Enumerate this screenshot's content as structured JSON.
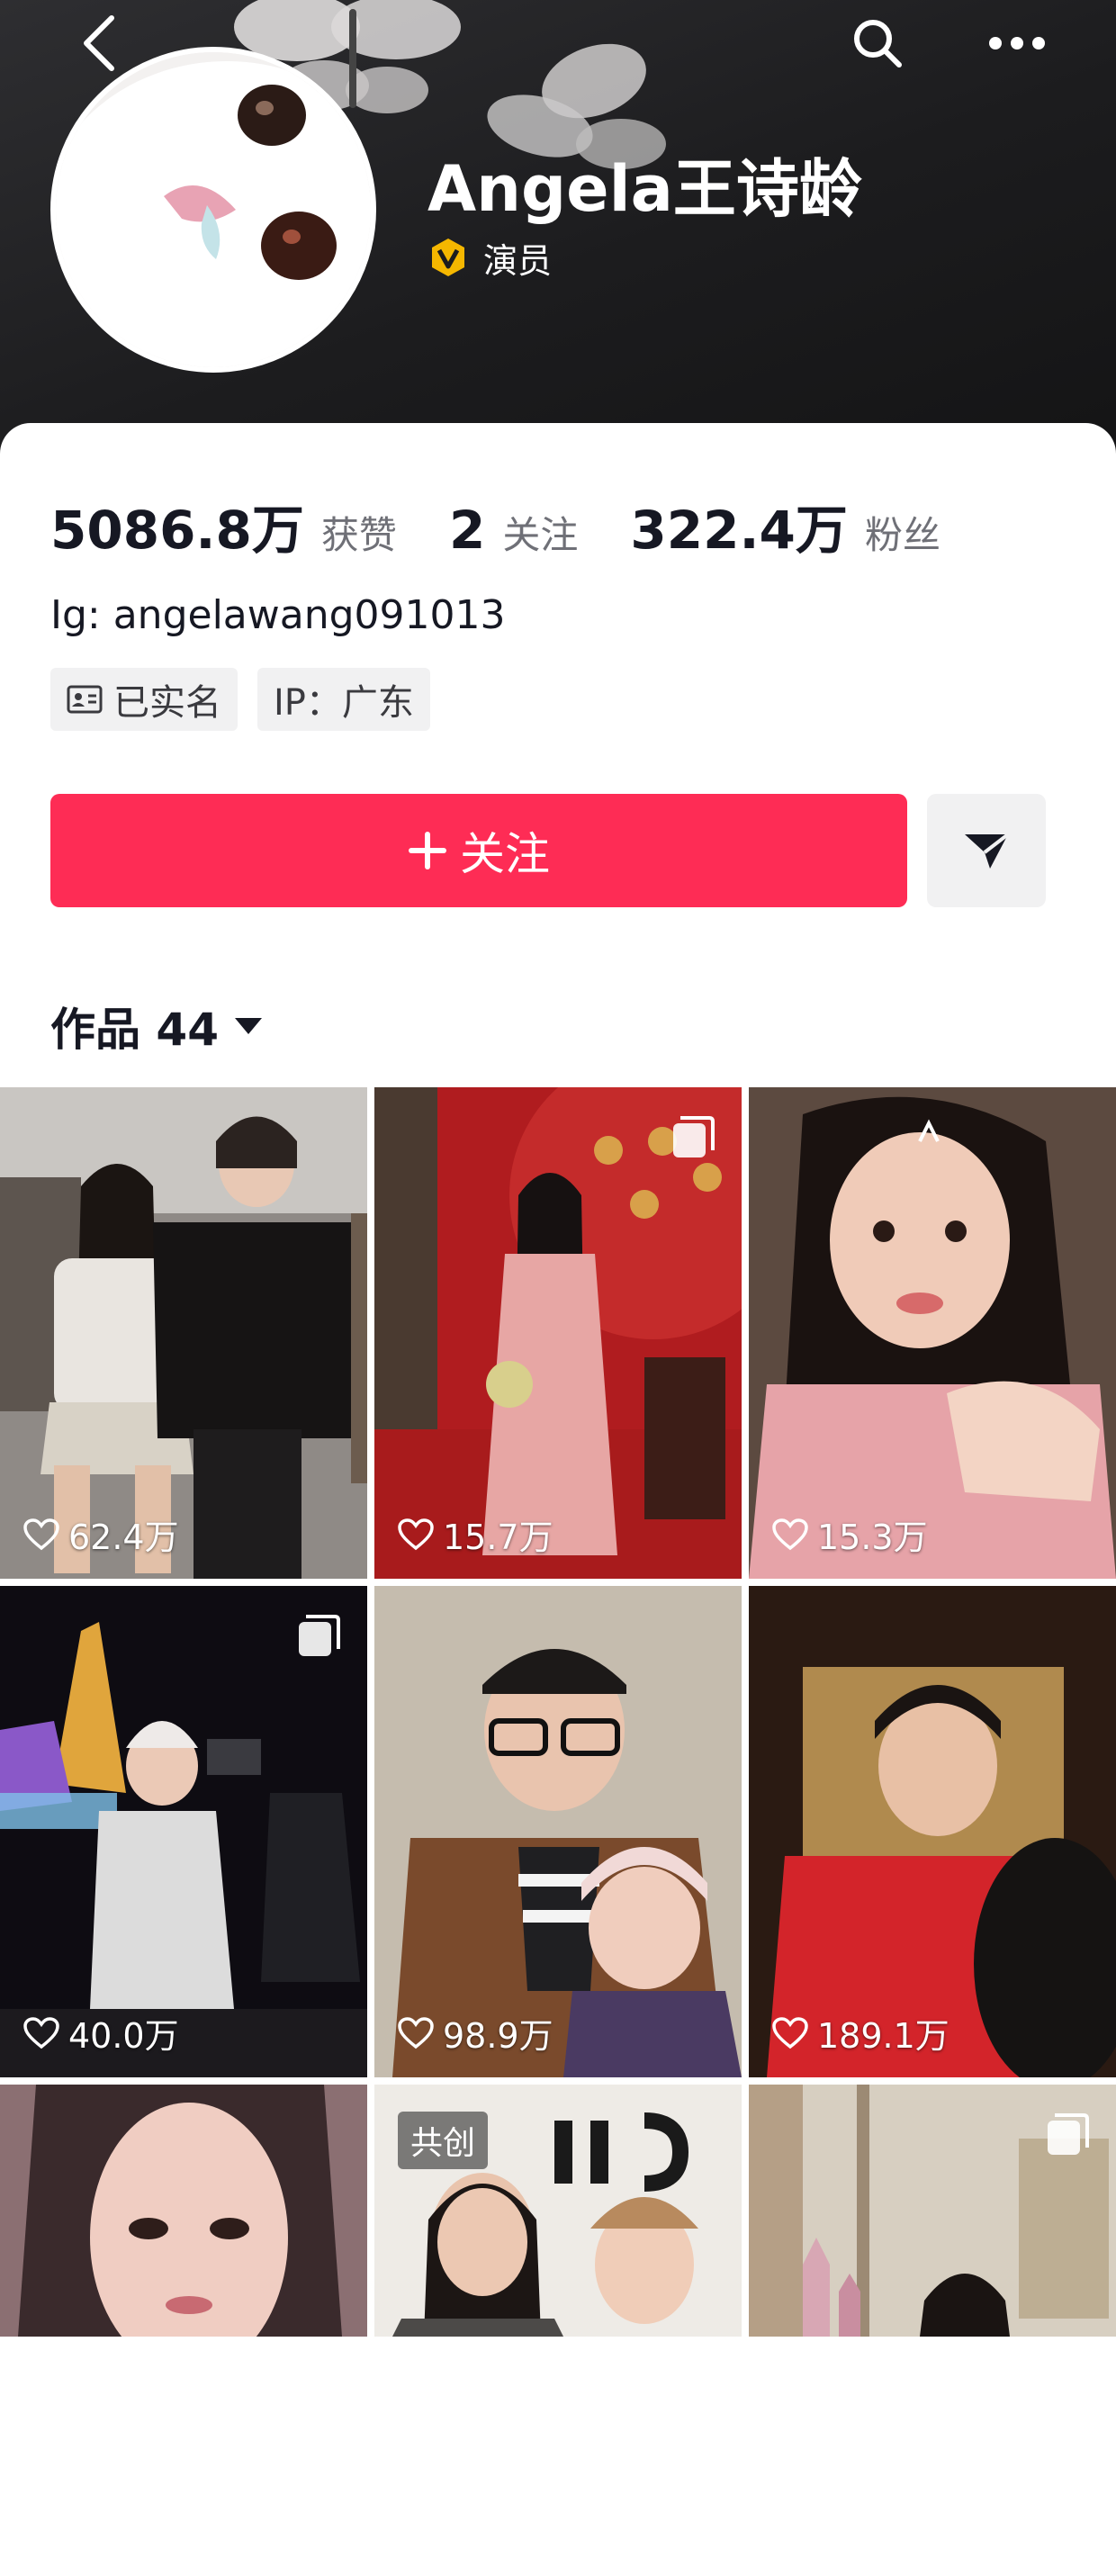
{
  "profile": {
    "name": "Angela王诗龄",
    "verification_label": "演员",
    "bio": "Ig: angelawang091013",
    "tags": [
      {
        "icon": "id-card-icon",
        "label": "已实名"
      },
      {
        "icon": "",
        "label": "IP：广东"
      }
    ]
  },
  "stats": [
    {
      "value": "5086.8万",
      "label": "获赞"
    },
    {
      "value": "2",
      "label": "关注"
    },
    {
      "value": "322.4万",
      "label": "粉丝"
    }
  ],
  "actions": {
    "follow_label": "关注"
  },
  "works_tab": {
    "label": "作品 44"
  },
  "grid": [
    {
      "likes": "62.4万",
      "multi": false,
      "cocreate": ""
    },
    {
      "likes": "15.7万",
      "multi": true,
      "cocreate": ""
    },
    {
      "likes": "15.3万",
      "multi": false,
      "cocreate": ""
    },
    {
      "likes": "40.0万",
      "multi": true,
      "cocreate": ""
    },
    {
      "likes": "98.9万",
      "multi": false,
      "cocreate": ""
    },
    {
      "likes": "189.1万",
      "multi": false,
      "cocreate": ""
    },
    {
      "likes": "",
      "multi": false,
      "cocreate": ""
    },
    {
      "likes": "",
      "multi": false,
      "cocreate": "共创"
    },
    {
      "likes": "",
      "multi": true,
      "cocreate": ""
    }
  ],
  "colors": {
    "accent": "#fe2c55",
    "header_bg": "#1c1c1e",
    "verify_gold": "#f5b700"
  }
}
